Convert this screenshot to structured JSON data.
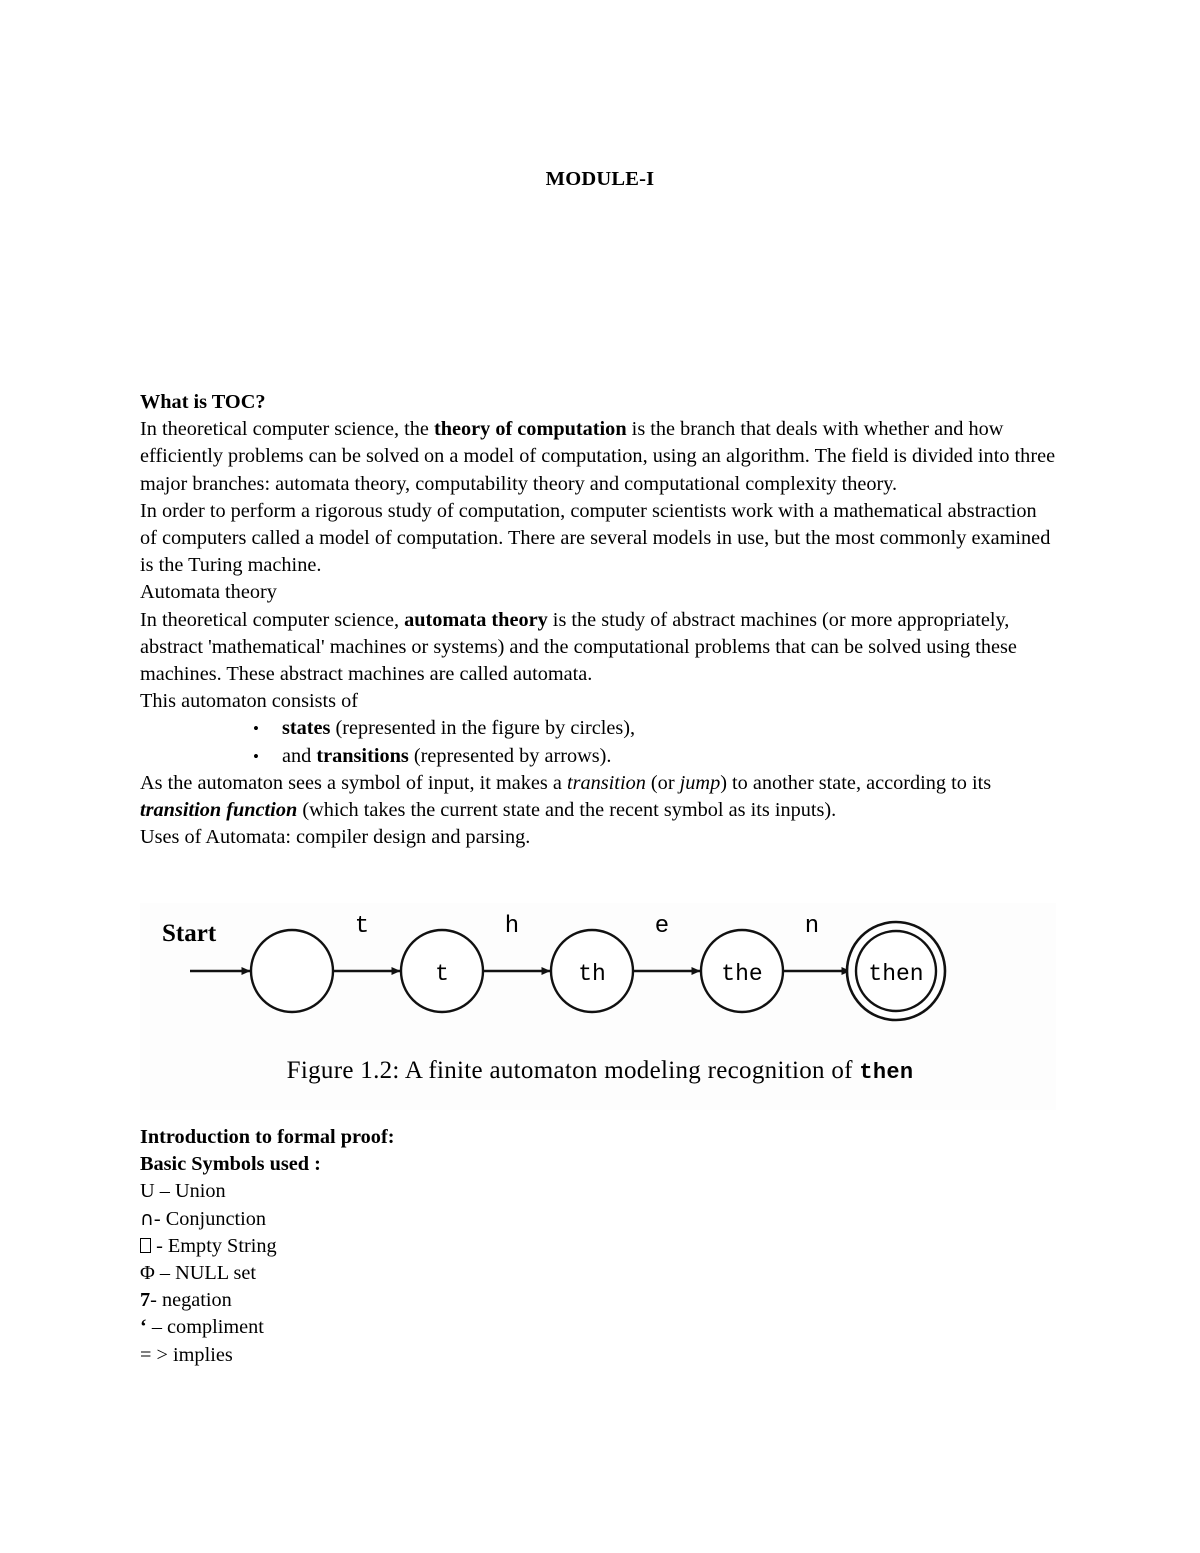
{
  "document": {
    "title": "MODULE-I"
  },
  "sections": {
    "toc": {
      "heading": "What is TOC?",
      "para1_a": " In theoretical computer science, the ",
      "para1_bold": "theory of computation",
      "para1_b": " is the branch that deals with whether and how efficiently problems can be solved on a model of computation, using an algorithm. The field is divided into three major branches: automata theory, computability theory and computational complexity theory.",
      "para2": "In order to perform a rigorous study of computation, computer scientists work with a mathematical abstraction of computers called a model of computation. There are several models in use, but the most commonly examined is the Turing machine.",
      "subheading": "Automata theory",
      "para3_a": "In theoretical computer science, ",
      "para3_bold": "automata theory",
      "para3_b": " is the study of abstract machines (or more appropriately, abstract 'mathematical' machines or systems) and the computational problems that can be solved using these machines. These abstract machines are called automata.",
      "para4": "This automaton consists of"
    },
    "automaton_parts": {
      "bullet_marker": "•",
      "items": [
        {
          "bold": "states",
          "rest": " (represented in the figure by circles),"
        },
        {
          "prefix": "and ",
          "bold": "transitions",
          "rest": " (represented by arrows)."
        }
      ]
    },
    "transition": {
      "part_a": " As the automaton sees a symbol of input, it makes a ",
      "italic_1": "transition",
      "part_b": " (or ",
      "italic_2": "jump",
      "part_c": ") to another state, according to its ",
      "bolditalic": "transition function",
      "part_d": " (which takes the current state and the recent symbol as its inputs).",
      "uses": "Uses of Automata: compiler design and parsing."
    },
    "formal_proof": {
      "heading1": "Introduction to formal proof:",
      "heading2": "Basic Symbols used :",
      "symbols": [
        {
          "glyph": "U",
          "text": " – Union",
          "style": "serif"
        },
        {
          "glyph": "∩",
          "text": "- Conjunction",
          "style": "sans"
        },
        {
          "glyph": "",
          "text": " - Empty String",
          "style": "tofu"
        },
        {
          "glyph": "Φ",
          "text": " – NULL set",
          "style": "serif"
        },
        {
          "glyph": "7",
          "text": "- negation",
          "style": "bold"
        },
        {
          "glyph": "‘",
          "text": " – compliment",
          "style": "bold"
        },
        {
          "glyph": "= >",
          "text": " implies",
          "style": "serif"
        }
      ]
    }
  },
  "figure": {
    "start_label": "Start",
    "caption_text": "Figure 1.2: A finite automaton modeling recognition of ",
    "caption_mono": "then",
    "states": [
      {
        "label": "",
        "accepting": false
      },
      {
        "label": "t",
        "accepting": false
      },
      {
        "label": "th",
        "accepting": false
      },
      {
        "label": "the",
        "accepting": false
      },
      {
        "label": "then",
        "accepting": true
      }
    ],
    "transitions": [
      {
        "symbol": "t"
      },
      {
        "symbol": "h"
      },
      {
        "symbol": "e"
      },
      {
        "symbol": "n"
      }
    ]
  },
  "colors": {
    "ink": "#000000",
    "page": "#ffffff",
    "figure_bg": "#fdfdfd"
  }
}
